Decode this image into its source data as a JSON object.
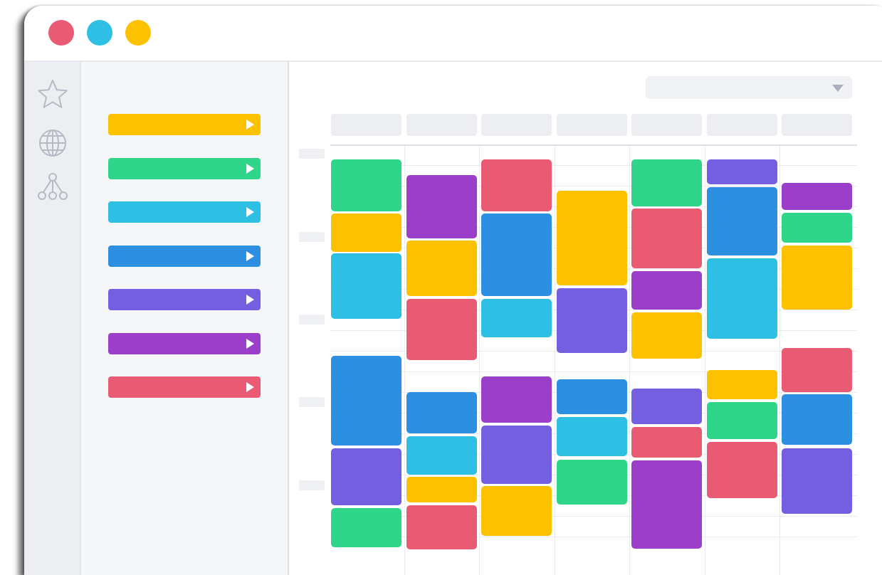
{
  "window": {
    "controls": [
      {
        "name": "close",
        "color": "#e85b73"
      },
      {
        "name": "minimize",
        "color": "#2ec0e4"
      },
      {
        "name": "maximize",
        "color": "#fcc200"
      }
    ]
  },
  "rail": {
    "icons": [
      "star-icon",
      "globe-icon",
      "network-icon"
    ]
  },
  "categories": [
    {
      "color": "#fcc200",
      "label": ""
    },
    {
      "color": "#2fd68a",
      "label": ""
    },
    {
      "color": "#2ec0e4",
      "label": ""
    },
    {
      "color": "#2d8fe1",
      "label": ""
    },
    {
      "color": "#735fe0",
      "label": ""
    },
    {
      "color": "#9b3fcb",
      "label": ""
    },
    {
      "color": "#e85b73",
      "label": ""
    }
  ],
  "view_select": {
    "value": "",
    "icon": "caret-down-icon"
  },
  "calendar": {
    "days": [
      "",
      "",
      "",
      "",
      "",
      "",
      ""
    ],
    "time_labels": [
      "",
      "",
      "",
      "",
      ""
    ],
    "events": [
      {
        "day": 0,
        "color": "green"
      },
      {
        "day": 0,
        "color": "yellow"
      },
      {
        "day": 0,
        "color": "cyan"
      },
      {
        "day": 0,
        "color": "blue"
      },
      {
        "day": 0,
        "color": "indigo"
      },
      {
        "day": 0,
        "color": "green"
      },
      {
        "day": 1,
        "color": "purple"
      },
      {
        "day": 1,
        "color": "yellow"
      },
      {
        "day": 1,
        "color": "red"
      },
      {
        "day": 1,
        "color": "blue"
      },
      {
        "day": 1,
        "color": "cyan"
      },
      {
        "day": 1,
        "color": "yellow"
      },
      {
        "day": 1,
        "color": "red"
      },
      {
        "day": 2,
        "color": "red"
      },
      {
        "day": 2,
        "color": "blue"
      },
      {
        "day": 2,
        "color": "cyan"
      },
      {
        "day": 2,
        "color": "purple"
      },
      {
        "day": 2,
        "color": "indigo"
      },
      {
        "day": 2,
        "color": "yellow"
      },
      {
        "day": 3,
        "color": "yellow"
      },
      {
        "day": 3,
        "color": "indigo"
      },
      {
        "day": 3,
        "color": "blue"
      },
      {
        "day": 3,
        "color": "cyan"
      },
      {
        "day": 3,
        "color": "green"
      },
      {
        "day": 4,
        "color": "green"
      },
      {
        "day": 4,
        "color": "red"
      },
      {
        "day": 4,
        "color": "purple"
      },
      {
        "day": 4,
        "color": "yellow"
      },
      {
        "day": 4,
        "color": "indigo"
      },
      {
        "day": 4,
        "color": "red"
      },
      {
        "day": 4,
        "color": "purple"
      },
      {
        "day": 5,
        "color": "indigo"
      },
      {
        "day": 5,
        "color": "blue"
      },
      {
        "day": 5,
        "color": "cyan"
      },
      {
        "day": 5,
        "color": "yellow"
      },
      {
        "day": 5,
        "color": "green"
      },
      {
        "day": 5,
        "color": "red"
      },
      {
        "day": 6,
        "color": "purple"
      },
      {
        "day": 6,
        "color": "green"
      },
      {
        "day": 6,
        "color": "yellow"
      },
      {
        "day": 6,
        "color": "red"
      },
      {
        "day": 6,
        "color": "blue"
      },
      {
        "day": 6,
        "color": "indigo"
      }
    ]
  },
  "palette": {
    "green": "#2fd68a",
    "yellow": "#fcc200",
    "cyan": "#2ec0e4",
    "blue": "#2d8fe1",
    "indigo": "#735fe0",
    "purple": "#9b3fcb",
    "red": "#e85b73"
  }
}
